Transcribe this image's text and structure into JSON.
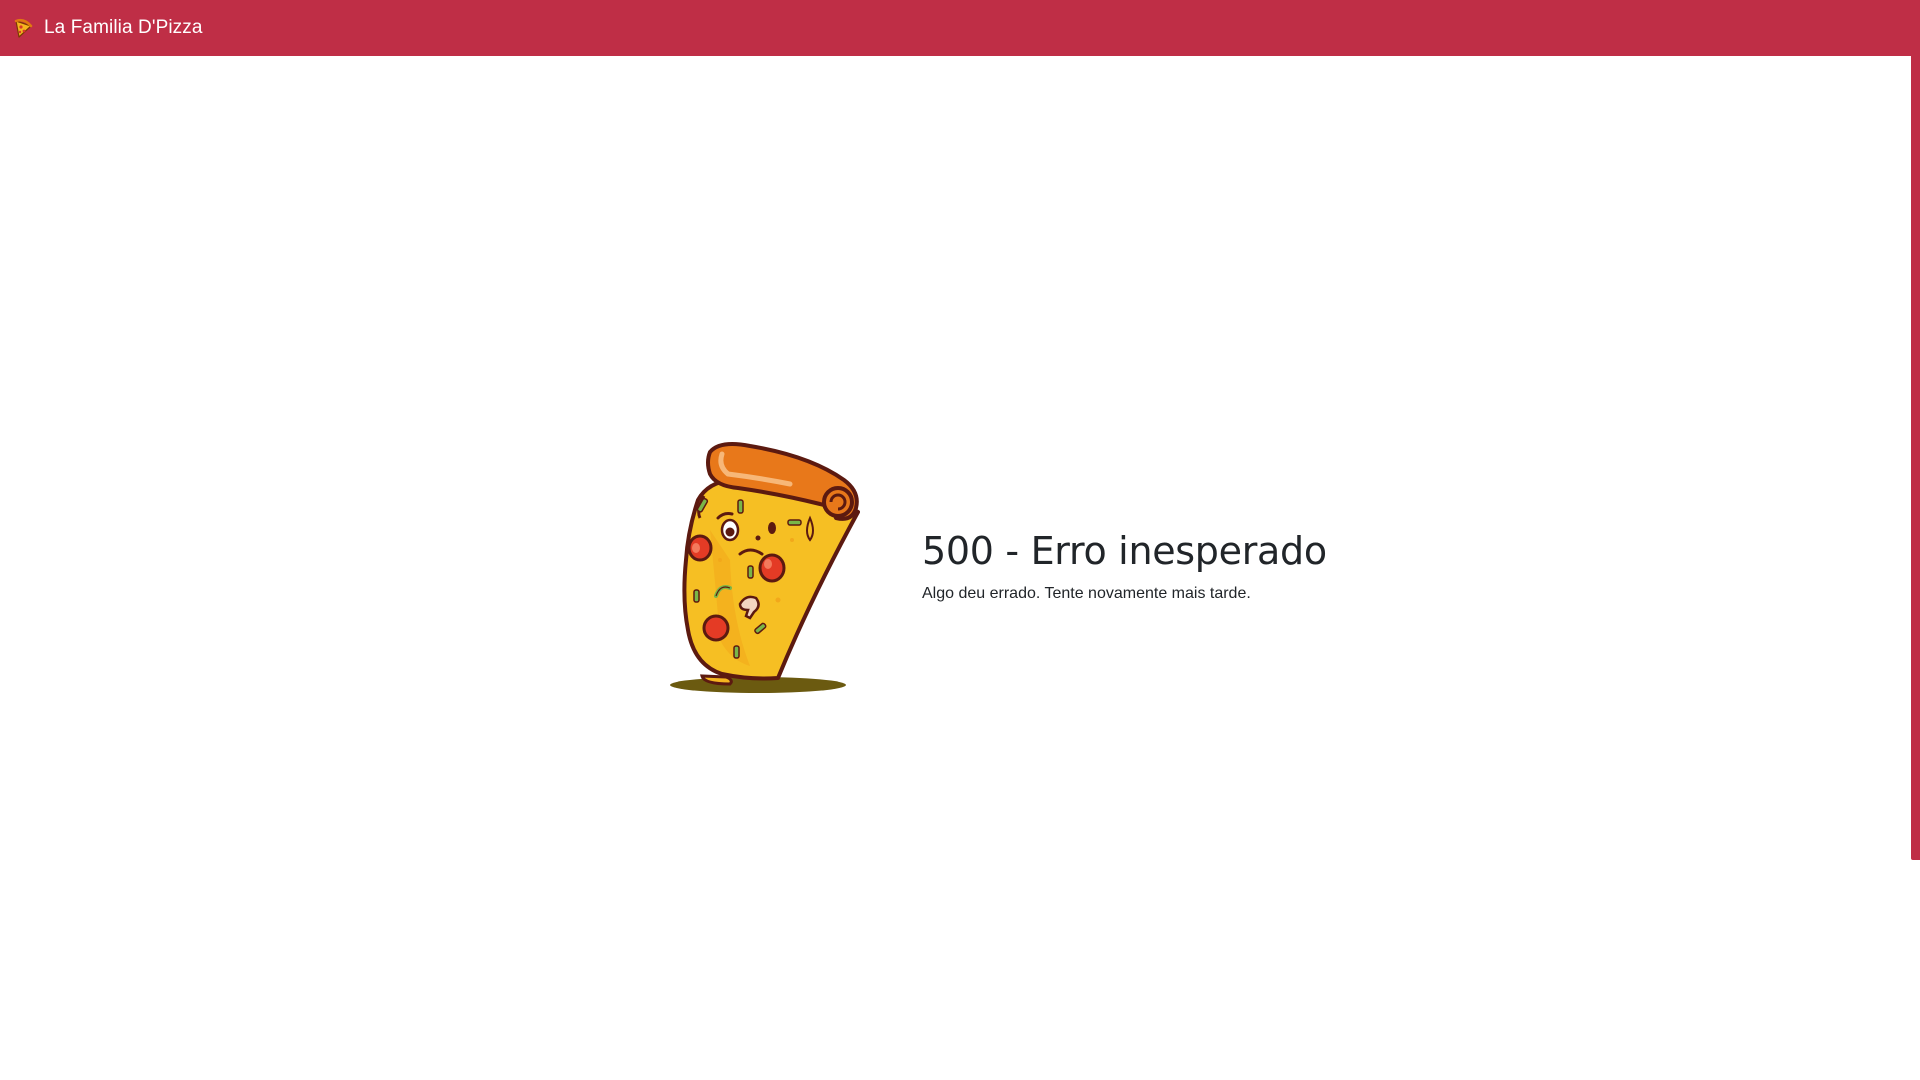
{
  "navbar": {
    "brand": "La Familia D'Pizza",
    "brand_icon": "pizza-icon",
    "background": "#bf2e46"
  },
  "error": {
    "title": "500 - Erro inesperado",
    "message": "Algo deu errado. Tente novamente mais tarde.",
    "illustration": "sad-pizza-illustration"
  }
}
